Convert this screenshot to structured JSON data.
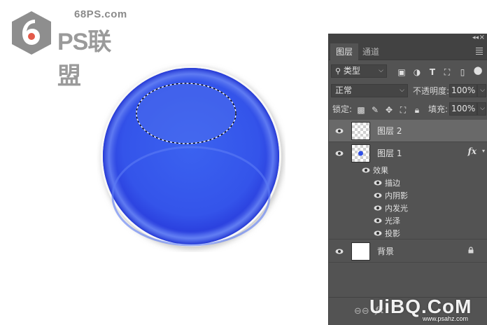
{
  "logo": {
    "site": "68PS.com",
    "brand": "PS联盟"
  },
  "panel": {
    "tabs": [
      "图层",
      "通道"
    ],
    "filter": {
      "label": "类型"
    },
    "blend_mode": "正常",
    "opacity_label": "不透明度:",
    "opacity_value": "100%",
    "lock_label": "锁定:",
    "fill_label": "填充:",
    "fill_value": "100%",
    "layers": [
      {
        "name": "图层 2",
        "selected": true,
        "thumb": "transparent"
      },
      {
        "name": "图层 1",
        "selected": false,
        "thumb": "transparent-dot",
        "fx": "fx"
      },
      {
        "name": "背景",
        "selected": false,
        "thumb": "white",
        "locked": true
      }
    ],
    "effects_label": "效果",
    "effects": [
      "描边",
      "内阴影",
      "内发光",
      "光泽",
      "投影"
    ]
  },
  "watermark": {
    "uibq": "UiBQ.CoM",
    "url": "www.psahz.com"
  },
  "colors": {
    "ball": "#2f4fe6",
    "panel": "#535353",
    "selected_layer": "#696969"
  }
}
